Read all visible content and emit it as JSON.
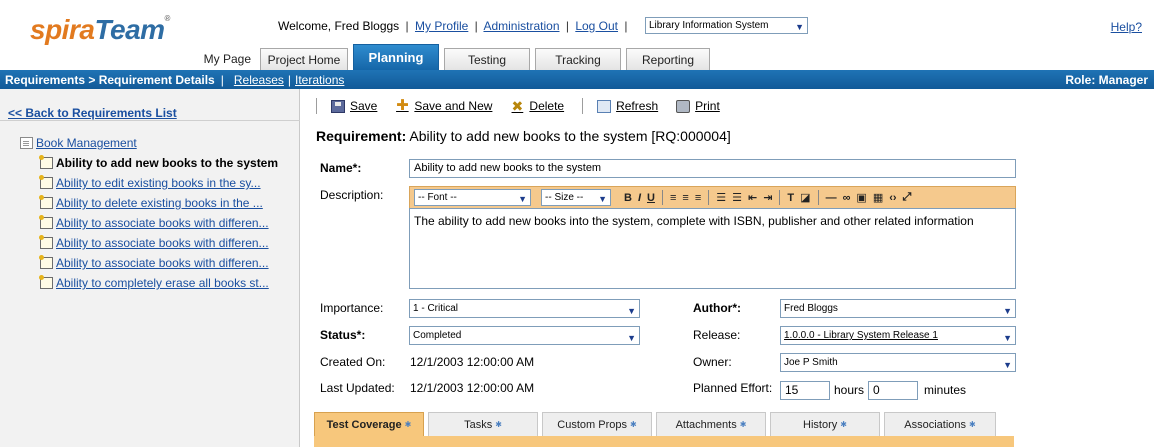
{
  "logo": {
    "part1": "spira",
    "part2": "Team",
    "reg": "®"
  },
  "header": {
    "welcome": "Welcome, Fred Bloggs",
    "links": [
      "My Profile",
      "Administration",
      "Log Out"
    ],
    "project_select": "Library Information System",
    "help": "Help?"
  },
  "tabs": [
    {
      "label": "My Page"
    },
    {
      "label": "Project Home"
    },
    {
      "label": "Planning"
    },
    {
      "label": "Testing"
    },
    {
      "label": "Tracking"
    },
    {
      "label": "Reporting"
    }
  ],
  "navbar": {
    "breadcrumb": "Requirements > Requirement Details",
    "links": [
      "Releases",
      "Iterations"
    ],
    "role": "Role: Manager"
  },
  "left": {
    "back": "<< Back to Requirements List",
    "root": "Book Management",
    "items": [
      "Ability to add new books to the system",
      "Ability to edit existing books in the sy...",
      "Ability to delete existing books in the ...",
      "Ability to associate books with differen...",
      "Ability to associate books with differen...",
      "Ability to associate books with differen...",
      "Ability to completely erase all books st..."
    ]
  },
  "toolbar": {
    "save": "Save",
    "save_new": "Save and New",
    "delete": "Delete",
    "refresh": "Refresh",
    "print": "Print"
  },
  "requirement": {
    "label": "Requirement:",
    "title": "Ability to add new books to the system [RQ:000004]"
  },
  "form": {
    "name_label": "Name*:",
    "name_value": "Ability to add new books to the system",
    "desc_label": "Description:",
    "font_select": "-- Font --",
    "size_select": "-- Size --",
    "desc_value": "The ability to add new books into the system, complete with ISBN, publisher and other related information",
    "importance_label": "Importance:",
    "importance_value": "1 - Critical",
    "status_label": "Status*:",
    "status_value": "Completed",
    "created_label": "Created On:",
    "created_value": "12/1/2003 12:00:00 AM",
    "updated_label": "Last Updated:",
    "updated_value": "12/1/2003 12:00:00 AM",
    "author_label": "Author*:",
    "author_value": "Fred Bloggs",
    "release_label": "Release:",
    "release_value": "1.0.0.0 - Library System Release 1",
    "owner_label": "Owner:",
    "owner_value": "Joe P Smith",
    "effort_label": "Planned Effort:",
    "effort_hours": "15",
    "hours_label": "hours",
    "effort_minutes": "0",
    "minutes_label": "minutes"
  },
  "bottom_tabs": [
    {
      "label": "Test Coverage"
    },
    {
      "label": "Tasks"
    },
    {
      "label": "Custom Props"
    },
    {
      "label": "Attachments"
    },
    {
      "label": "History"
    },
    {
      "label": "Associations"
    }
  ],
  "colors": {
    "accent_blue": "#1566a8",
    "logo_orange": "#e27a1f",
    "rte_bar": "#f5c98d",
    "active_bottom_tab": "#f7c77c"
  }
}
